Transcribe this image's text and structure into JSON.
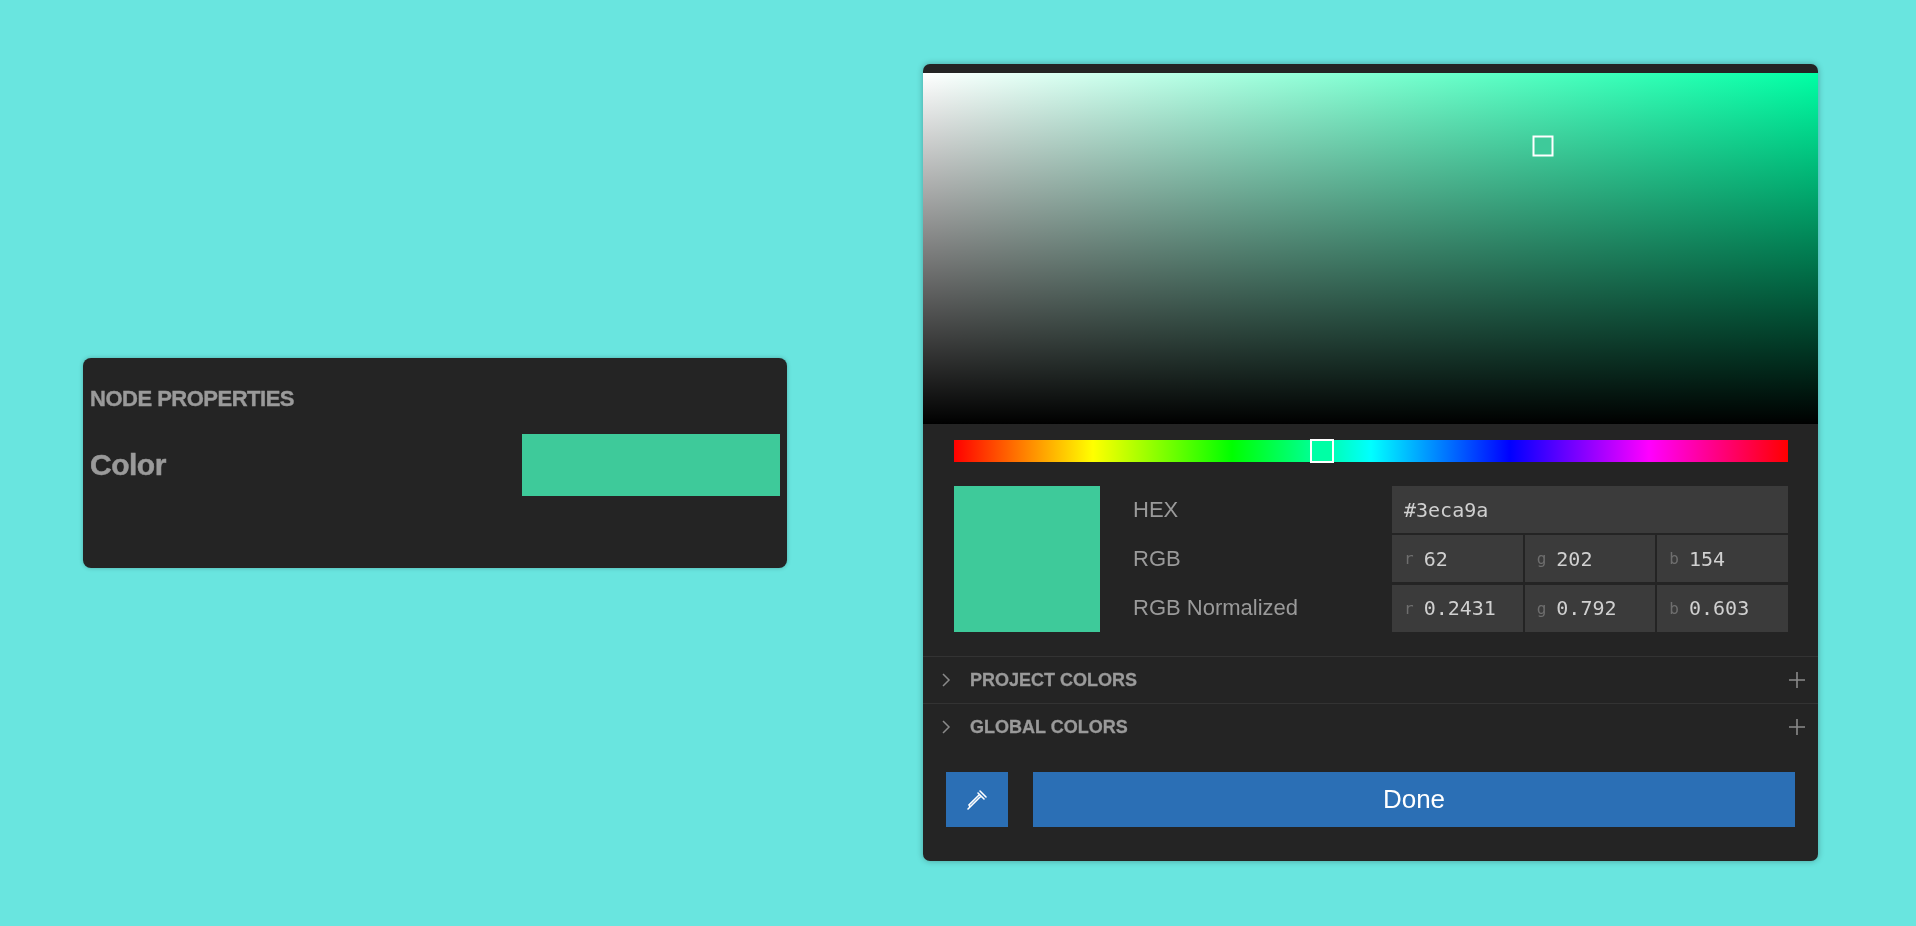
{
  "node_panel": {
    "title": "NODE PROPERTIES",
    "property": {
      "label": "Color",
      "color": "#3eca9a"
    }
  },
  "color_picker": {
    "hue_slider": {
      "level": 0.441
    },
    "fields": [
      {
        "label": "HEX",
        "inputs": [
          {
            "value": "#3eca9a"
          }
        ]
      },
      {
        "label": "RGB",
        "inputs": [
          {
            "prefix": "r",
            "value": "62"
          },
          {
            "prefix": "g",
            "value": "202"
          },
          {
            "prefix": "b",
            "value": "154"
          }
        ]
      },
      {
        "label": "RGB Normalized",
        "inputs": [
          {
            "prefix": "r",
            "value": "0.2431"
          },
          {
            "prefix": "g",
            "value": "0.792"
          },
          {
            "prefix": "b",
            "value": "0.603"
          }
        ]
      }
    ],
    "sections": [
      {
        "title": "PROJECT COLORS",
        "expanded": false
      },
      {
        "title": "GLOBAL COLORS",
        "expanded": false
      }
    ],
    "done_button": "Done"
  }
}
